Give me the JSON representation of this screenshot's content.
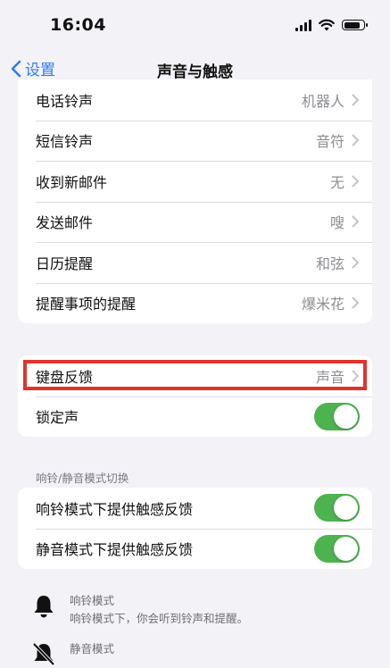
{
  "status_bar": {
    "time": "16:04",
    "battery_level": 0.85
  },
  "nav": {
    "back_label": "设置",
    "title": "声音与触感"
  },
  "ringtones": [
    {
      "label": "电话铃声",
      "value": "机器人"
    },
    {
      "label": "短信铃声",
      "value": "音符"
    },
    {
      "label": "收到新邮件",
      "value": "无"
    },
    {
      "label": "发送邮件",
      "value": "嗖"
    },
    {
      "label": "日历提醒",
      "value": "和弦"
    },
    {
      "label": "提醒事项的提醒",
      "value": "爆米花"
    }
  ],
  "system_sounds": {
    "keyboard_feedback": {
      "label": "键盘反馈",
      "value": "声音"
    },
    "lock_sound": {
      "label": "锁定声",
      "on": true
    }
  },
  "haptics": {
    "header": "响铃/静音模式切换",
    "ring_haptics": {
      "label": "响铃模式下提供触感反馈",
      "on": true
    },
    "silent_haptics": {
      "label": "静音模式下提供触感反馈",
      "on": true
    }
  },
  "modes": {
    "ring": {
      "title": "响铃模式",
      "description": "响铃模式下，你会听到铃声和提醒。"
    },
    "silent": {
      "title": "静音模式"
    }
  },
  "colors": {
    "accent": "#2f7cf6",
    "toggle_on": "#4cb34f",
    "highlight": "#e0332d"
  }
}
